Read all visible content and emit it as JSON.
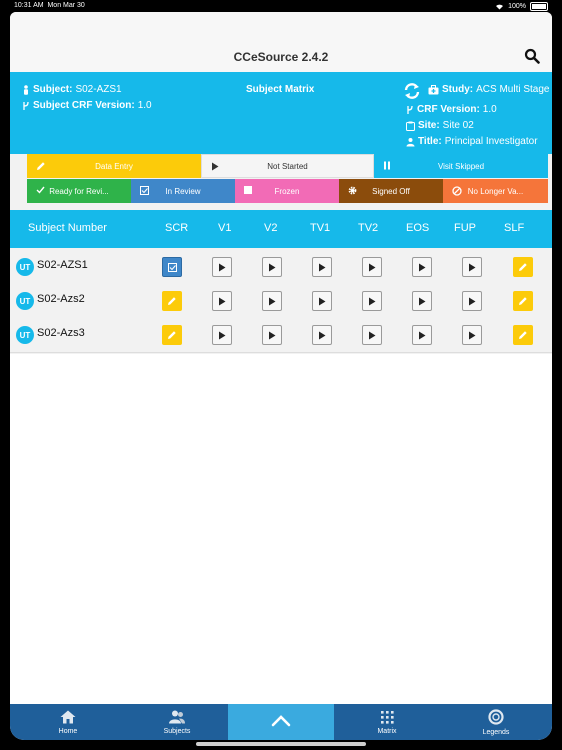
{
  "status": {
    "time": "10:31 AM",
    "date": "Mon Mar 30",
    "battery": "100%"
  },
  "app": {
    "title": "CCeSource 2.4.2"
  },
  "info": {
    "subject_label": "Subject:",
    "subject_value": "S02-AZS1",
    "crf_label": "Subject CRF Version:",
    "crf_value": "1.0",
    "center_title": "Subject Matrix",
    "study_label": "Study:",
    "study_value": "ACS Multi Stage",
    "crf_version_label": "CRF Version:",
    "crf_version_value": "1.0",
    "site_label": "Site:",
    "site_value": "Site 02",
    "title_label": "Title:",
    "title_value": "Principal Investigator"
  },
  "legend": [
    {
      "label": "Data Entry",
      "color": "#fccb0a",
      "text_color": "#ffffff",
      "icon": "pencil-icon"
    },
    {
      "label": "Not Started",
      "color": "#f5f5f5",
      "text_color": "#333333",
      "icon": "play-icon"
    },
    {
      "label": "Visit Skipped",
      "color": "#16b9ea",
      "text_color": "#ffffff",
      "icon": "pause-icon"
    },
    {
      "label": "Ready for Revi...",
      "color": "#2fb34a",
      "text_color": "#ffffff",
      "icon": "check-icon"
    },
    {
      "label": "In Review",
      "color": "#3f87c9",
      "text_color": "#ffffff",
      "icon": "checkbox-icon"
    },
    {
      "label": "Frozen",
      "color": "#f26bb6",
      "text_color": "#ffffff",
      "icon": "square-icon"
    },
    {
      "label": "Signed Off",
      "color": "#8b4c0c",
      "text_color": "#ffffff",
      "icon": "gear-icon"
    },
    {
      "label": "No Longer Va...",
      "color": "#f5753a",
      "text_color": "#ffffff",
      "icon": "ban-icon"
    }
  ],
  "matrix": {
    "columns": [
      "Subject Number",
      "SCR",
      "V1",
      "V2",
      "TV1",
      "TV2",
      "EOS",
      "FUP",
      "SLF"
    ],
    "rows": [
      {
        "avatar": "UT",
        "subject": "S02-AZS1",
        "cells": [
          "in-review",
          "not-started",
          "not-started",
          "not-started",
          "not-started",
          "not-started",
          "not-started",
          "data-entry"
        ]
      },
      {
        "avatar": "UT",
        "subject": "S02-Azs2",
        "cells": [
          "data-entry",
          "not-started",
          "not-started",
          "not-started",
          "not-started",
          "not-started",
          "not-started",
          "data-entry"
        ]
      },
      {
        "avatar": "UT",
        "subject": "S02-Azs3",
        "cells": [
          "data-entry",
          "not-started",
          "not-started",
          "not-started",
          "not-started",
          "not-started",
          "not-started",
          "data-entry"
        ]
      }
    ]
  },
  "tabs": [
    {
      "label": "Home",
      "icon": "home-icon"
    },
    {
      "label": "Subjects",
      "icon": "subjects-icon"
    },
    {
      "label": "",
      "icon": "chevron-up-icon"
    },
    {
      "label": "Matrix",
      "icon": "grid-icon"
    },
    {
      "label": "Legends",
      "icon": "lifebuoy-icon"
    }
  ],
  "colors": {
    "accent": "#16b9ea",
    "tabbar": "#1f5f9a",
    "data_entry": "#fccb0a",
    "in_review": "#3f87c9"
  }
}
